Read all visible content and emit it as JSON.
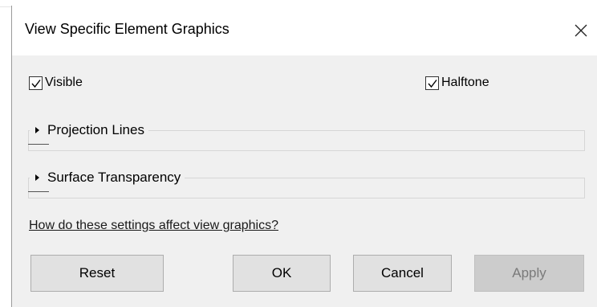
{
  "dialog": {
    "title": "View Specific Element Graphics"
  },
  "checkboxes": {
    "visible": {
      "label": "Visible",
      "checked": true
    },
    "halftone": {
      "label": "Halftone",
      "checked": true
    }
  },
  "groups": [
    {
      "title": "Projection Lines",
      "expanded": false
    },
    {
      "title": "Surface Transparency",
      "expanded": false
    }
  ],
  "help": {
    "link_text": "How do these settings affect view graphics?"
  },
  "buttons": {
    "reset": "Reset",
    "ok": "OK",
    "cancel": "Cancel",
    "apply": "Apply",
    "apply_enabled": false
  },
  "icons": {
    "close": "close-icon",
    "checkmark": "checkmark-icon",
    "expander": "triangle-right-icon"
  },
  "colors": {
    "dialog_background": "#f0f0f0",
    "titlebar_background": "#ffffff",
    "button_background": "#e1e1e1",
    "button_disabled_background": "#cccccc",
    "button_disabled_text": "#7a7a7a"
  }
}
